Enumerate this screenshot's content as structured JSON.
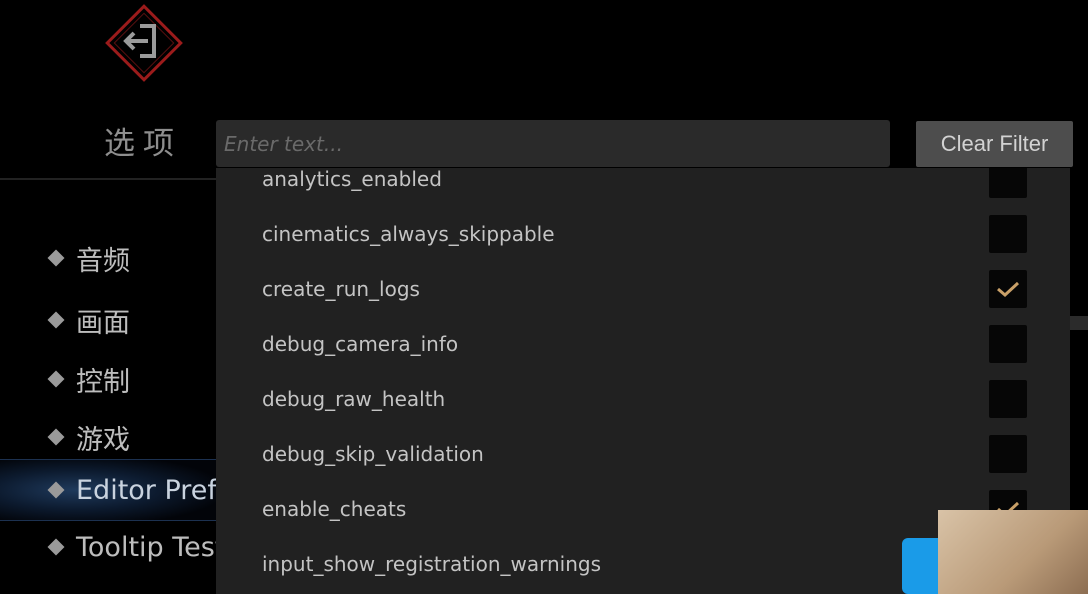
{
  "header": {
    "title": "选项",
    "filter_placeholder": "Enter text...",
    "filter_value": "",
    "clear_filter_label": "Clear Filter"
  },
  "sidebar": {
    "items": [
      {
        "label": "音频",
        "active": false
      },
      {
        "label": "画面",
        "active": false
      },
      {
        "label": "控制",
        "active": false
      },
      {
        "label": "游戏",
        "active": false
      },
      {
        "label": "Editor Prefs",
        "active": true
      },
      {
        "label": "Tooltip Test",
        "active": false
      }
    ]
  },
  "prefs": {
    "rows": [
      {
        "name": "analytics_enabled",
        "checked": false
      },
      {
        "name": "cinematics_always_skippable",
        "checked": false
      },
      {
        "name": "create_run_logs",
        "checked": true
      },
      {
        "name": "debug_camera_info",
        "checked": false
      },
      {
        "name": "debug_raw_health",
        "checked": false
      },
      {
        "name": "debug_skip_validation",
        "checked": false
      },
      {
        "name": "enable_cheats",
        "checked": true
      },
      {
        "name": "input_show_registration_warnings",
        "checked": false
      }
    ]
  },
  "colors": {
    "accent_check": "#c9a068",
    "panel_bg": "#212121",
    "emblem_red": "#9b1b1b"
  },
  "icons": {
    "back": "exit-arrow-icon",
    "check": "checkmark-icon"
  }
}
